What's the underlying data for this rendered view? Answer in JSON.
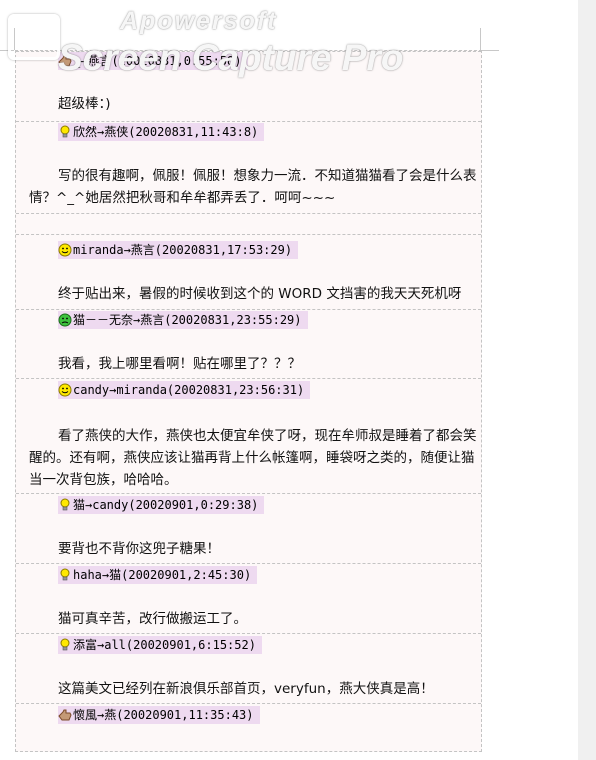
{
  "watermark": {
    "line1": "Apowersoft",
    "line2": "Screen Capture Pro"
  },
  "entries": [
    {
      "header": "_→燕言(20020831,0:55:58)",
      "body": "超级棒：)",
      "icon": "thumbs-hand-icon"
    },
    {
      "header": "欣然→燕侠(20020831,11:43:8)",
      "body": "写的很有趣啊，佩服！佩服！想象力一流．不知道猫猫看了会是什么表情？^_^她居然把秋哥和牟牟都弄丢了．呵呵~~~",
      "icon": "lightbulb-icon"
    },
    {
      "header": "miranda→燕言(20020831,17:53:29)",
      "body": "终于贴出来，暑假的时候收到这个的 WORD 文挡害的我天天死机呀",
      "icon": "smiley-icon"
    },
    {
      "header": "猫－－无奈→燕言(20020831,23:55:29)",
      "body": "我看，我上哪里看啊！贴在哪里了？？？",
      "icon": "green-face-icon"
    },
    {
      "header": "candy→miranda(20020831,23:56:31)",
      "body": "看了燕侠的大作，燕侠也太便宜牟侠了呀，现在牟师叔是睡着了都会笑醒的。还有啊，燕侠应该让猫再背上什么帐篷啊，睡袋呀之类的，随便让猫当一次背包族，哈哈哈。",
      "icon": "smiley-icon"
    },
    {
      "header": "猫→candy(20020901,0:29:38)",
      "body": "要背也不背你这兜子糖果！",
      "icon": "lightbulb-icon"
    },
    {
      "header": "haha→猫(20020901,2:45:30)",
      "body": "猫可真辛苦，改行做搬运工了。",
      "icon": "lightbulb-icon"
    },
    {
      "header": "添富→all(20020901,6:15:52)",
      "body": "这篇美文已经列在新浪俱乐部首页，veryfun，燕大侠真是高！",
      "icon": "lightbulb-icon"
    },
    {
      "header": "懷風→燕(20020901,11:35:43)",
      "body": "",
      "icon": "thumbs-hand-icon"
    }
  ]
}
